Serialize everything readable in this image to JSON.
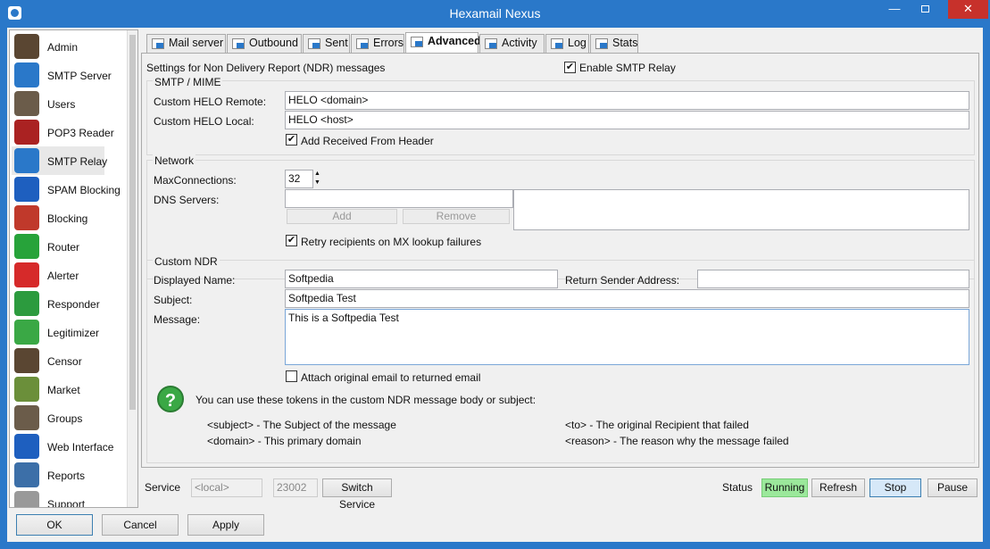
{
  "window": {
    "title": "Hexamail Nexus"
  },
  "sidebar": {
    "items": [
      {
        "label": "Admin",
        "icon": "admin-user-icon",
        "color": "#5a4632"
      },
      {
        "label": "SMTP Server",
        "icon": "smtp-server-icon",
        "color": "#2a78c9"
      },
      {
        "label": "Users",
        "icon": "users-icon",
        "color": "#6b5c4a"
      },
      {
        "label": "POP3 Reader",
        "icon": "pop3-reader-icon",
        "color": "#a22"
      },
      {
        "label": "SMTP Relay",
        "icon": "smtp-relay-icon",
        "color": "#2a78c9"
      },
      {
        "label": "SPAM Blocking",
        "icon": "spam-blocking-icon",
        "color": "#1e5fbf"
      },
      {
        "label": "Blocking",
        "icon": "blocking-icon",
        "color": "#c0392b"
      },
      {
        "label": "Router",
        "icon": "router-icon",
        "color": "#27a33a"
      },
      {
        "label": "Alerter",
        "icon": "alerter-icon",
        "color": "#d62a2a"
      },
      {
        "label": "Responder",
        "icon": "responder-icon",
        "color": "#2c9b3e"
      },
      {
        "label": "Legitimizer",
        "icon": "legitimizer-icon",
        "color": "#3aa845"
      },
      {
        "label": "Censor",
        "icon": "censor-icon",
        "color": "#5a4632"
      },
      {
        "label": "Market",
        "icon": "market-icon",
        "color": "#6b8f3a"
      },
      {
        "label": "Groups",
        "icon": "groups-icon",
        "color": "#6b5c4a"
      },
      {
        "label": "Web Interface",
        "icon": "web-interface-icon",
        "color": "#1e5fbf"
      },
      {
        "label": "Reports",
        "icon": "reports-icon",
        "color": "#3c6fa8"
      },
      {
        "label": "Support",
        "icon": "support-icon",
        "color": "#999"
      }
    ],
    "selected": "SMTP Relay"
  },
  "tabs": [
    {
      "label": "Mail server"
    },
    {
      "label": "Outbound"
    },
    {
      "label": "Sent"
    },
    {
      "label": "Errors"
    },
    {
      "label": "Advanced"
    },
    {
      "label": "Activity"
    },
    {
      "label": "Log"
    },
    {
      "label": "Stats"
    }
  ],
  "active_tab": "Advanced",
  "advanced": {
    "intro": "Settings for Non Delivery Report (NDR) messages",
    "enable_relay_label": "Enable SMTP Relay",
    "enable_relay_checked": true,
    "smtp_mime": {
      "title": "SMTP / MIME",
      "helo_remote_label": "Custom HELO Remote:",
      "helo_remote_value": "HELO <domain>",
      "helo_local_label": "Custom HELO Local:",
      "helo_local_value": "HELO <host>",
      "add_received_label": "Add Received From Header",
      "add_received_checked": true
    },
    "network": {
      "title": "Network",
      "max_conn_label": "MaxConnections:",
      "max_conn_value": "32",
      "dns_label": "DNS Servers:",
      "dns_value": "",
      "add_label": "Add",
      "remove_label": "Remove",
      "retry_label": "Retry recipients on MX lookup failures",
      "retry_checked": true
    },
    "custom_ndr": {
      "title": "Custom NDR",
      "displayed_name_label": "Displayed Name:",
      "displayed_name_value": "Softpedia",
      "return_sender_label": "Return Sender Address:",
      "return_sender_value": "",
      "subject_label": "Subject:",
      "subject_value": "Softpedia Test",
      "message_label": "Message:",
      "message_value": "This is a Softpedia Test",
      "attach_label": "Attach original email to returned email",
      "attach_checked": false
    },
    "tokens": {
      "intro": "You can use these tokens in the custom NDR message body or subject:",
      "subject_token": "<subject> - The Subject of the message",
      "domain_token": "<domain> - This primary domain",
      "to_token": "<to> - The original Recipient that failed",
      "reason_token": "<reason> - The reason why the message failed"
    }
  },
  "service_bar": {
    "service_label": "Service",
    "host_value": "<local>",
    "port_value": "23002",
    "switch_label": "Switch Service",
    "status_label": "Status",
    "status_value": "Running",
    "refresh_label": "Refresh",
    "stop_label": "Stop",
    "pause_label": "Pause"
  },
  "footer": {
    "ok_label": "OK",
    "cancel_label": "Cancel",
    "apply_label": "Apply"
  },
  "colors": {
    "titlebar": "#2a78c9",
    "close": "#c7312b",
    "running": "#9be89b",
    "help": "#3aa845"
  }
}
